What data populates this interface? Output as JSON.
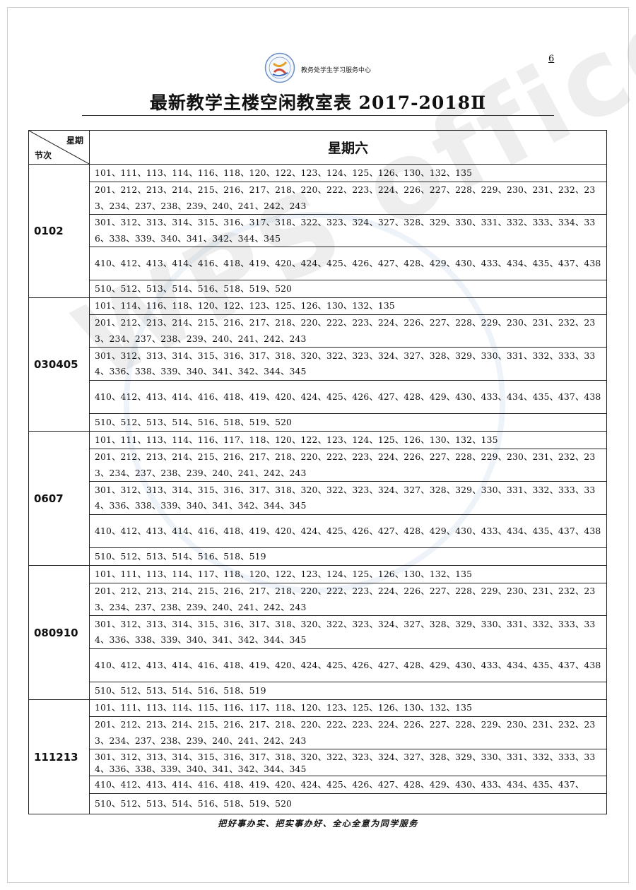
{
  "header": {
    "org_name": "教务处学生学习服务中心",
    "page_number": "6"
  },
  "title": "最新教学主楼空闲教室表 2017-2018Ⅱ",
  "table": {
    "corner_top": "星期",
    "corner_bottom": "节次",
    "day": "星期六",
    "slots": [
      {
        "label": "0102",
        "rows": [
          "101、111、113、114、116、118、120、122、123、124、125、126、130、132、135",
          "201、212、213、214、215、216、217、218、220、222、223、224、226、227、228、229、230、231、232、233、234、237、238、239、240、241、242、243",
          "301、312、313、314、315、316、317、318、322、323、324、327、328、329、330、331、332、333、334、336、338、339、340、341、342、344、345",
          "410、412、413、414、416、418、419、420、424、425、426、427、428、429、430、433、434、435、437、438",
          "510、512、513、514、516、518、519、520"
        ]
      },
      {
        "label": "030405",
        "rows": [
          "101、114、116、118、120、122、123、125、126、130、132、135",
          "201、212、213、214、215、216、217、218、220、222、223、224、226、227、228、229、230、231、232、233、234、237、238、239、240、241、242、243",
          "301、312、313、314、315、316、317、318、320、322、323、324、327、328、329、330、331、332、333、334、336、338、339、340、341、342、344、345",
          "410、412、413、414、416、418、419、420、424、425、426、427、428、429、430、433、434、435、437、438",
          "510、512、513、514、516、518、519、520"
        ]
      },
      {
        "label": "0607",
        "rows": [
          "101、111、113、114、116、117、118、120、122、123、124、125、126、130、132、135",
          "201、212、213、214、215、216、217、218、220、222、223、224、226、227、228、229、230、231、232、233、234、237、238、239、240、241、242、243",
          "301、312、313、314、315、316、317、318、320、322、323、324、327、328、329、330、331、332、333、334、336、338、339、340、341、342、344、345",
          "410、412、413、414、416、418、419、420、424、425、426、427、428、429、430、433、434、435、437、438",
          "510、512、513、514、516、518、519"
        ]
      },
      {
        "label": "080910",
        "rows": [
          "101、111、113、114、117、118、120、122、123、124、125、126、130、132、135",
          "201、212、213、214、215、216、217、218、220、222、223、224、226、227、228、229、230、231、232、233、234、237、238、239、240、241、242、243",
          "301、312、313、314、315、316、317、318、320、322、323、324、327、328、329、330、331、332、333、334、336、338、339、340、341、342、344、345",
          "410、412、413、414、416、418、419、420、424、425、426、427、428、429、430、433、434、435、437、438",
          "510、512、513、514、516、518、519"
        ]
      },
      {
        "label": "111213",
        "rows": [
          "101、111、113、114、115、116、117、118、120、123、125、126、130、132、135",
          "201、212、213、214、215、216、217、218、220、222、223、224、226、227、228、229、230、231、232、233、234、237、238、239、240、241、242、243",
          "301、312、313、314、315、316、317、318、320、322、323、324、327、328、329、330、331、332、333、334、336、338、339、340、341、342、344、345",
          "410、412、413、414、416、418、419、420、424、425、426、427、428、429、430、433、434、435、437、",
          "510、512、513、514、516、518、519、520"
        ]
      }
    ]
  },
  "watermark": "WPS office",
  "footer": "把好事办实、把实事办好、全心全意为同学服务"
}
